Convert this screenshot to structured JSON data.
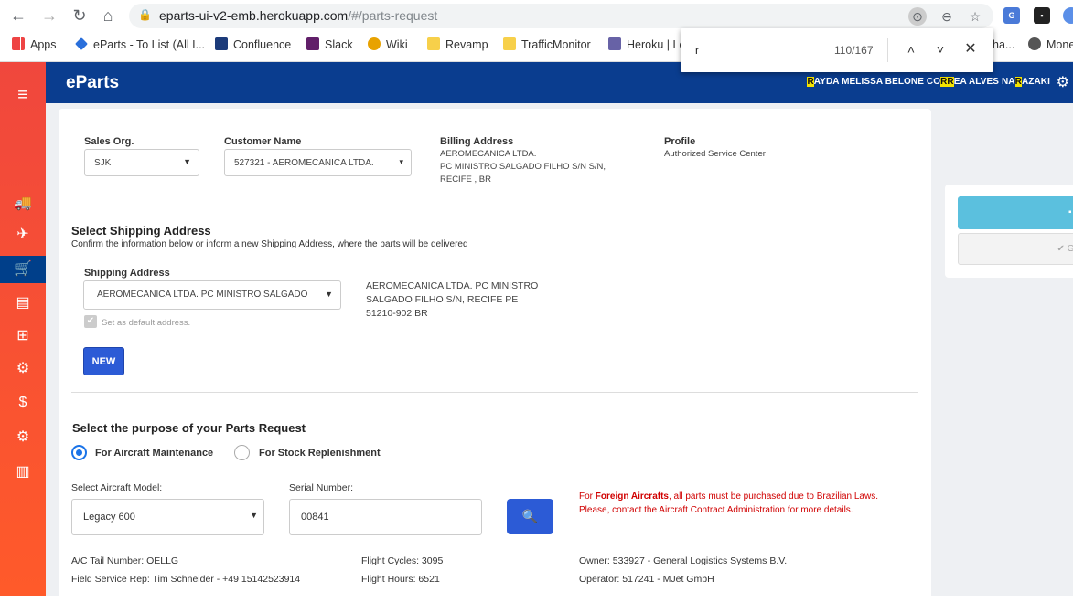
{
  "browser": {
    "url_main": "eparts-ui-v2-emb.herokuapp.com",
    "url_path": "/#/parts-request",
    "bookmarks": [
      "Apps",
      "eParts - To List (All I...",
      "Confluence",
      "Slack",
      "Wiki",
      "Revamp",
      "TrafficMonitor",
      "Heroku | Lo",
      "ha...",
      "Mone"
    ],
    "find": {
      "query": "r",
      "count": "110/167"
    }
  },
  "app": {
    "brand": "eParts",
    "user": {
      "p1": "R",
      "p2": "AYDA MELISSA BELONE CO",
      "p3": "RR",
      "p4": "EA ALVES NA",
      "p5": "R",
      "p6": "AZAKI"
    }
  },
  "form": {
    "sales_org_label": "Sales Org.",
    "sales_org_value": "SJK",
    "customer_label": "Customer Name",
    "customer_value": "527321 - AEROMECANICA LTDA.",
    "billing_label": "Billing Address",
    "billing_lines": [
      "AEROMECANICA LTDA.",
      "PC MINISTRO SALGADO FILHO S/N S/N,",
      "RECIFE , BR"
    ],
    "profile_label": "Profile",
    "profile_value": "Authorized Service Center",
    "shipping_title": "Select Shipping Address",
    "shipping_sub": "Confirm the information below or inform a new Shipping Address, where the parts will be delivered",
    "shipping_label": "Shipping Address",
    "shipping_value": "AEROMECANICA LTDA. PC MINISTRO SALGADO",
    "shipping_lines": [
      "AEROMECANICA LTDA. PC MINISTRO",
      "SALGADO FILHO S/N, RECIFE PE",
      "51210-902 BR"
    ],
    "default_label": "Set as default address.",
    "new_label": "NEW",
    "purpose_title": "Select the purpose of your Parts Request",
    "purpose_opt1": "For Aircraft Maintenance",
    "purpose_opt2": "For Stock Replenishment",
    "model_label": "Select Aircraft Model:",
    "model_value": "Legacy 600",
    "serial_label": "Serial Number:",
    "serial_value": "00841",
    "warn_pre": "For ",
    "warn_bold": "Foreign Aircrafts",
    "warn_post": ", all parts must be purchased due to Brazilian Laws. Please, contact the Aircraft Contract Administration for more details.",
    "tail": "A/C Tail Number: OELLG",
    "rep": "Field Service Rep: Tim Schneider - +49 15142523914",
    "cycles": "Flight Cycles: 3095",
    "hours": "Flight Hours: 6521",
    "owner": "Owner: 533927 - General Logistics Systems B.V.",
    "operator": "Operator: 517241 - MJet GmbH"
  },
  "actions": {
    "save": "S",
    "go": "✔ Go"
  }
}
